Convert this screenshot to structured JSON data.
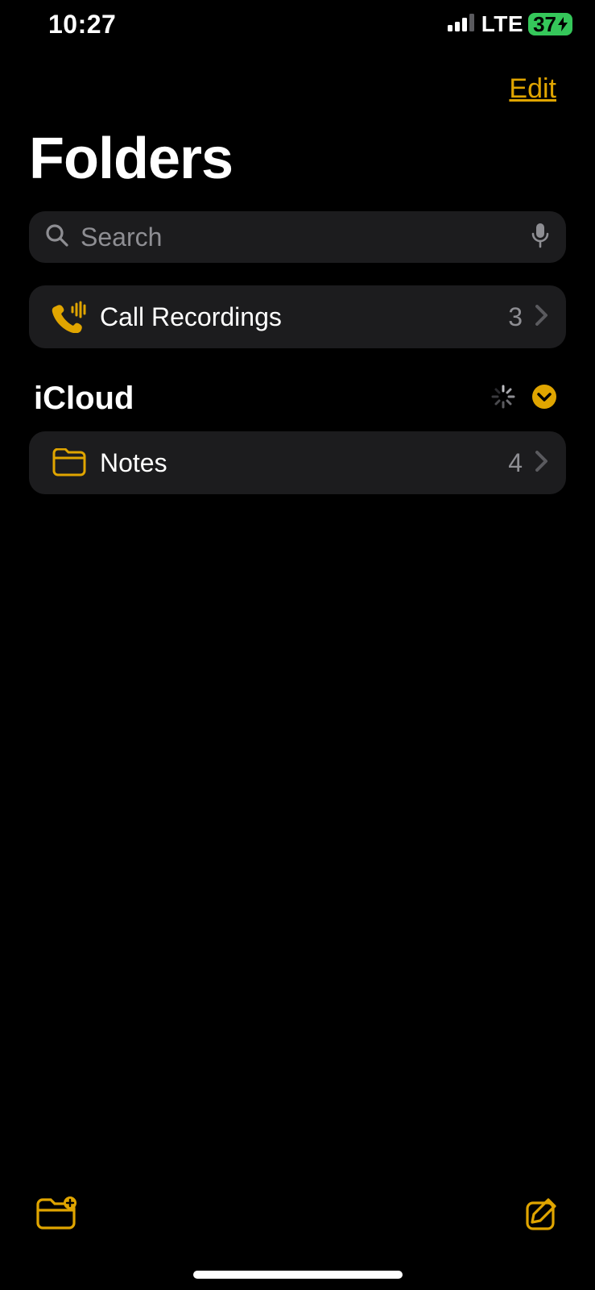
{
  "status": {
    "time": "10:27",
    "network": "LTE",
    "battery_percent": "37"
  },
  "nav": {
    "edit_label": "Edit"
  },
  "page": {
    "title": "Folders"
  },
  "search": {
    "placeholder": "Search"
  },
  "top_items": [
    {
      "icon": "phone-wave",
      "label": "Call Recordings",
      "count": "3"
    }
  ],
  "sections": [
    {
      "title": "iCloud",
      "loading": true,
      "expanded": true,
      "items": [
        {
          "icon": "folder",
          "label": "Notes",
          "count": "4"
        }
      ]
    }
  ],
  "colors": {
    "accent": "#e0a500",
    "card": "#1c1c1e",
    "muted": "#8e8e93",
    "battery": "#35c75a"
  }
}
